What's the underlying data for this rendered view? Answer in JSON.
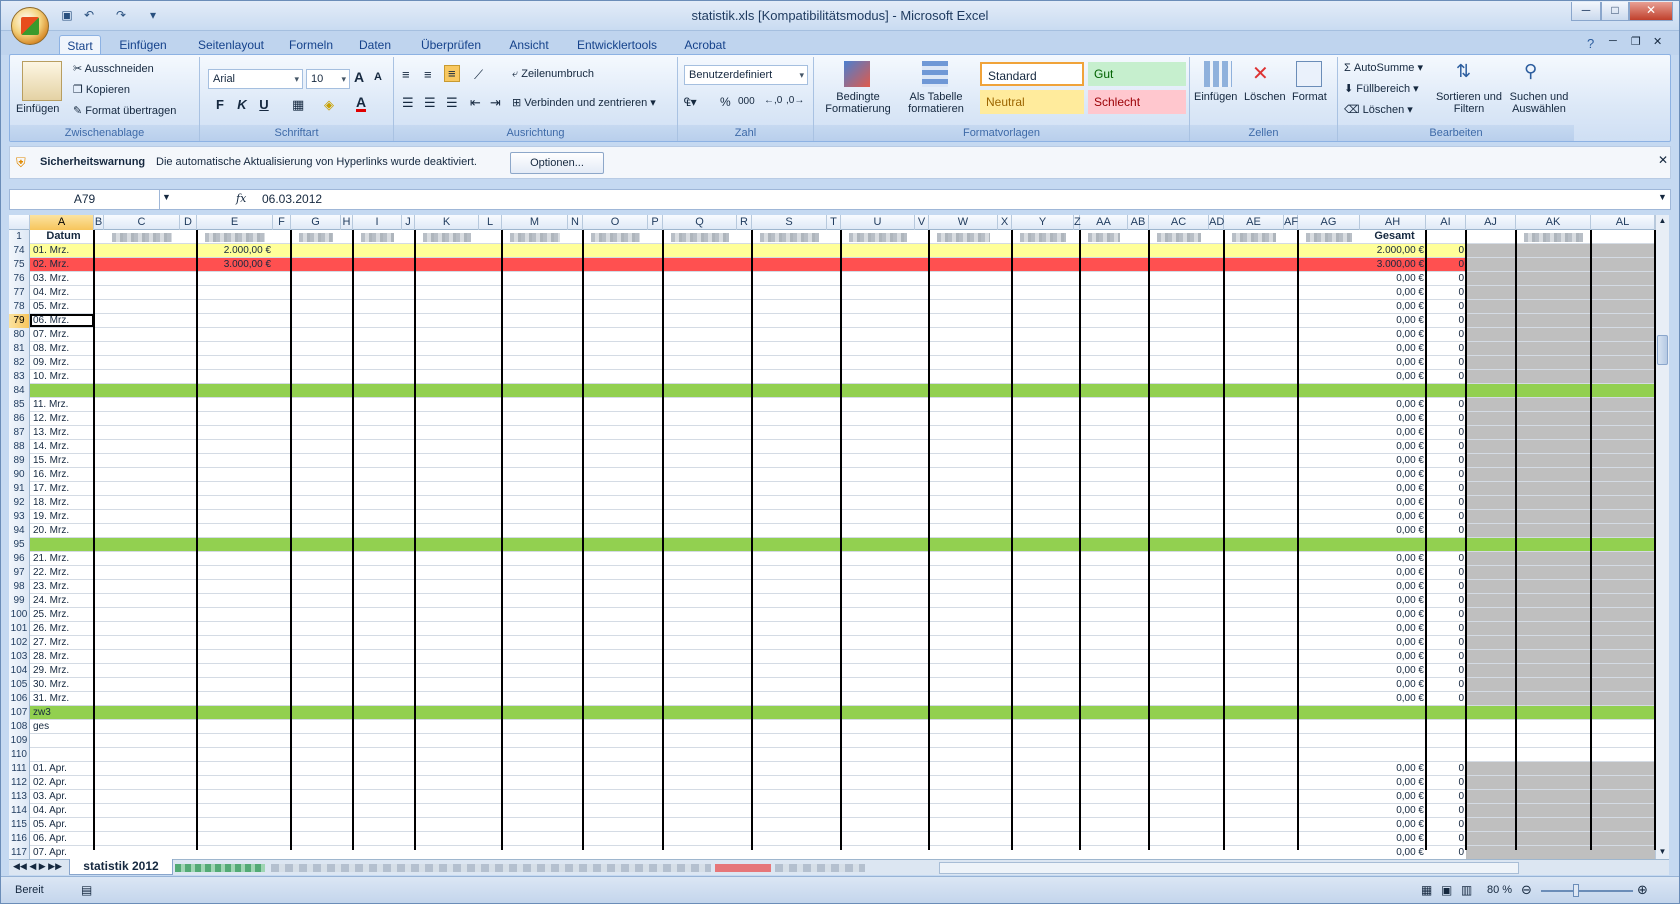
{
  "window": {
    "title": "statistik.xls  [Kompatibilitätsmodus] - Microsoft Excel",
    "minimize": "─",
    "maximize": "□",
    "close": "✕"
  },
  "ribbon": {
    "tabs": [
      "Start",
      "Einfügen",
      "Seitenlayout",
      "Formeln",
      "Daten",
      "Überprüfen",
      "Ansicht",
      "Entwicklertools",
      "Acrobat"
    ],
    "active_tab": "Start",
    "clipboard": {
      "paste": "Einfügen",
      "cut": "Ausschneiden",
      "copy": "Kopieren",
      "format_painter": "Format übertragen",
      "label": "Zwischenablage"
    },
    "font": {
      "name": "Arial",
      "size": "10",
      "bold": "F",
      "italic": "K",
      "underline": "U",
      "label": "Schriftart"
    },
    "alignment": {
      "wrap": "Zeilenumbruch",
      "merge": "Verbinden und zentrieren",
      "label": "Ausrichtung"
    },
    "number": {
      "format": "Benutzerdefiniert",
      "percent": "%",
      "thousands": "000",
      "label": "Zahl"
    },
    "styles": {
      "conditional": "Bedingte Formatierung",
      "as_table": "Als Tabelle formatieren",
      "standard": "Standard",
      "gut": "Gut",
      "neutral": "Neutral",
      "schlecht": "Schlecht",
      "label": "Formatvorlagen"
    },
    "cells": {
      "insert": "Einfügen",
      "delete": "Löschen",
      "format": "Format",
      "label": "Zellen"
    },
    "editing": {
      "autosum": "AutoSumme",
      "fill": "Füllbereich",
      "clear": "Löschen",
      "sort": "Sortieren und Filtern",
      "find": "Suchen und Auswählen",
      "label": "Bearbeiten"
    }
  },
  "security": {
    "title": "Sicherheitswarnung",
    "message": "Die automatische Aktualisierung von Hyperlinks wurde deaktiviert.",
    "button": "Optionen..."
  },
  "formula_bar": {
    "name_box": "A79",
    "fx": "fx",
    "value": "06.03.2012"
  },
  "columns": [
    "A",
    "B",
    "C",
    "D",
    "E",
    "F",
    "G",
    "H",
    "I",
    "J",
    "K",
    "L",
    "M",
    "N",
    "O",
    "P",
    "Q",
    "R",
    "S",
    "T",
    "U",
    "V",
    "W",
    "X",
    "Y",
    "Z",
    "AA",
    "AB",
    "AC",
    "AD",
    "AE",
    "AF",
    "AG",
    "AH",
    "AI",
    "AJ",
    "AK",
    "AL"
  ],
  "header_row": {
    "num": "1",
    "a": "Datum",
    "ah": "Gesamt"
  },
  "rows": [
    {
      "num": "74",
      "a": "01. Mrz.",
      "e": "2.000,00 €",
      "ah": "2.000,00 €",
      "ai": "0",
      "style": "yellow"
    },
    {
      "num": "75",
      "a": "02. Mrz.",
      "e": "3.000,00 €",
      "ah": "3.000,00 €",
      "ai": "0",
      "style": "red"
    },
    {
      "num": "76",
      "a": "03. Mrz.",
      "ah": "0,00 €",
      "ai": "0"
    },
    {
      "num": "77",
      "a": "04. Mrz.",
      "ah": "0,00 €",
      "ai": "0"
    },
    {
      "num": "78",
      "a": "05. Mrz.",
      "ah": "0,00 €",
      "ai": "0"
    },
    {
      "num": "79",
      "a": "06. Mrz.",
      "ah": "0,00 €",
      "ai": "0",
      "selected": true
    },
    {
      "num": "80",
      "a": "07. Mrz.",
      "ah": "0,00 €",
      "ai": "0"
    },
    {
      "num": "81",
      "a": "08. Mrz.",
      "ah": "0,00 €",
      "ai": "0"
    },
    {
      "num": "82",
      "a": "09. Mrz.",
      "ah": "0,00 €",
      "ai": "0"
    },
    {
      "num": "83",
      "a": "10. Mrz.",
      "ah": "0,00 €",
      "ai": "0"
    },
    {
      "num": "84",
      "style": "green"
    },
    {
      "num": "85",
      "a": "11. Mrz.",
      "ah": "0,00 €",
      "ai": "0"
    },
    {
      "num": "86",
      "a": "12. Mrz.",
      "ah": "0,00 €",
      "ai": "0"
    },
    {
      "num": "87",
      "a": "13. Mrz.",
      "ah": "0,00 €",
      "ai": "0"
    },
    {
      "num": "88",
      "a": "14. Mrz.",
      "ah": "0,00 €",
      "ai": "0"
    },
    {
      "num": "89",
      "a": "15. Mrz.",
      "ah": "0,00 €",
      "ai": "0"
    },
    {
      "num": "90",
      "a": "16. Mrz.",
      "ah": "0,00 €",
      "ai": "0"
    },
    {
      "num": "91",
      "a": "17. Mrz.",
      "ah": "0,00 €",
      "ai": "0"
    },
    {
      "num": "92",
      "a": "18. Mrz.",
      "ah": "0,00 €",
      "ai": "0"
    },
    {
      "num": "93",
      "a": "19. Mrz.",
      "ah": "0,00 €",
      "ai": "0"
    },
    {
      "num": "94",
      "a": "20. Mrz.",
      "ah": "0,00 €",
      "ai": "0"
    },
    {
      "num": "95",
      "style": "green"
    },
    {
      "num": "96",
      "a": "21. Mrz.",
      "ah": "0,00 €",
      "ai": "0"
    },
    {
      "num": "97",
      "a": "22. Mrz.",
      "ah": "0,00 €",
      "ai": "0"
    },
    {
      "num": "98",
      "a": "23. Mrz.",
      "ah": "0,00 €",
      "ai": "0"
    },
    {
      "num": "99",
      "a": "24. Mrz.",
      "ah": "0,00 €",
      "ai": "0"
    },
    {
      "num": "100",
      "a": "25. Mrz.",
      "ah": "0,00 €",
      "ai": "0"
    },
    {
      "num": "101",
      "a": "26. Mrz.",
      "ah": "0,00 €",
      "ai": "0"
    },
    {
      "num": "102",
      "a": "27. Mrz.",
      "ah": "0,00 €",
      "ai": "0"
    },
    {
      "num": "103",
      "a": "28. Mrz.",
      "ah": "0,00 €",
      "ai": "0"
    },
    {
      "num": "104",
      "a": "29. Mrz.",
      "ah": "0,00 €",
      "ai": "0"
    },
    {
      "num": "105",
      "a": "30. Mrz.",
      "ah": "0,00 €",
      "ai": "0"
    },
    {
      "num": "106",
      "a": "31. Mrz.",
      "ah": "0,00 €",
      "ai": "0"
    },
    {
      "num": "107",
      "a": "zw3",
      "style": "green"
    },
    {
      "num": "108",
      "a": "ges",
      "style": "plain"
    },
    {
      "num": "109",
      "style": "plain"
    },
    {
      "num": "110",
      "style": "plain"
    },
    {
      "num": "111",
      "a": "01. Apr.",
      "ah": "0,00 €",
      "ai": "0"
    },
    {
      "num": "112",
      "a": "02. Apr.",
      "ah": "0,00 €",
      "ai": "0"
    },
    {
      "num": "113",
      "a": "03. Apr.",
      "ah": "0,00 €",
      "ai": "0"
    },
    {
      "num": "114",
      "a": "04. Apr.",
      "ah": "0,00 €",
      "ai": "0"
    },
    {
      "num": "115",
      "a": "05. Apr.",
      "ah": "0,00 €",
      "ai": "0"
    },
    {
      "num": "116",
      "a": "06. Apr.",
      "ah": "0,00 €",
      "ai": "0"
    },
    {
      "num": "117",
      "a": "07. Apr.",
      "ah": "0,00 €",
      "ai": "0"
    }
  ],
  "sheet_tab": "statistik 2012",
  "status": {
    "ready": "Bereit",
    "zoom": "80 %"
  },
  "colors": {
    "yellow": "#ffff99",
    "red": "#ff5050",
    "green": "#92d050",
    "gray": "#bfbfbf",
    "selected_header": "#f7c55c"
  }
}
